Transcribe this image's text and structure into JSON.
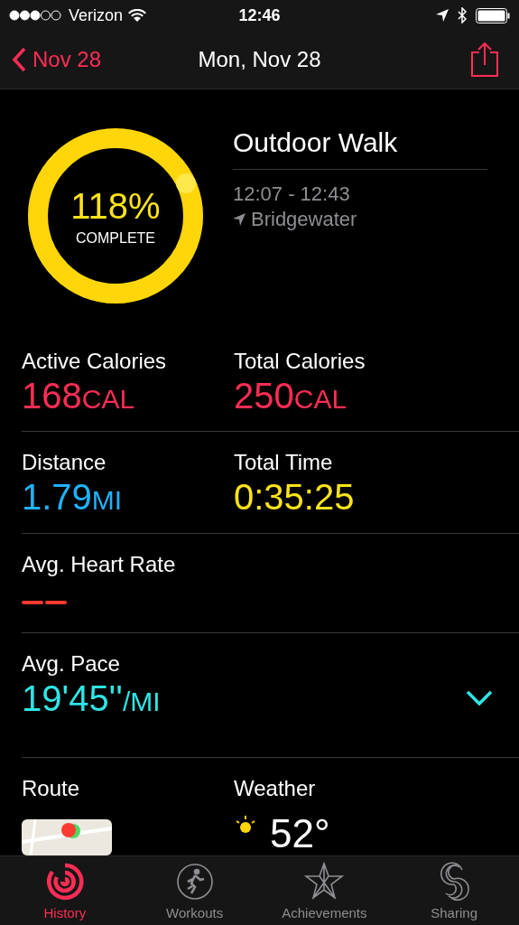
{
  "status_bar": {
    "carrier": "Verizon",
    "time": "12:46"
  },
  "nav": {
    "back": "Nov 28",
    "title": "Mon, Nov 28"
  },
  "workout": {
    "ring": {
      "level": 1,
      "percent": "118%",
      "caption": "COMPLETE"
    },
    "title": "Outdoor Walk",
    "time_range": "12:07 - 12:43",
    "location": "Bridgewater"
  },
  "stats": [
    {
      "label": "Active Calories",
      "value": "168",
      "unit": "CAL",
      "color": "#ff2d55"
    },
    {
      "label": "Total Calories",
      "value": "250",
      "unit": "CAL",
      "color": "#ff2d55"
    },
    {
      "label": "Distance",
      "value": "1.79",
      "unit": "MI",
      "color": "#1fb2ff"
    },
    {
      "label": "Total Time",
      "value": "0:35:25",
      "color": "#ffe31a"
    }
  ],
  "heart_rate": {
    "label": "Avg. Heart Rate"
  },
  "pace": {
    "label": "Avg. Pace",
    "value": "19'45''",
    "unit": "/MI",
    "expanded": false
  },
  "route": {
    "label": "Route"
  },
  "weather": {
    "label": "Weather",
    "temperature": "52°"
  },
  "tabs": [
    {
      "label": "History",
      "selected": true
    },
    {
      "label": "Workouts",
      "selected": false
    },
    {
      "label": "Achievements",
      "selected": false
    },
    {
      "label": "Sharing",
      "selected": false
    }
  ]
}
